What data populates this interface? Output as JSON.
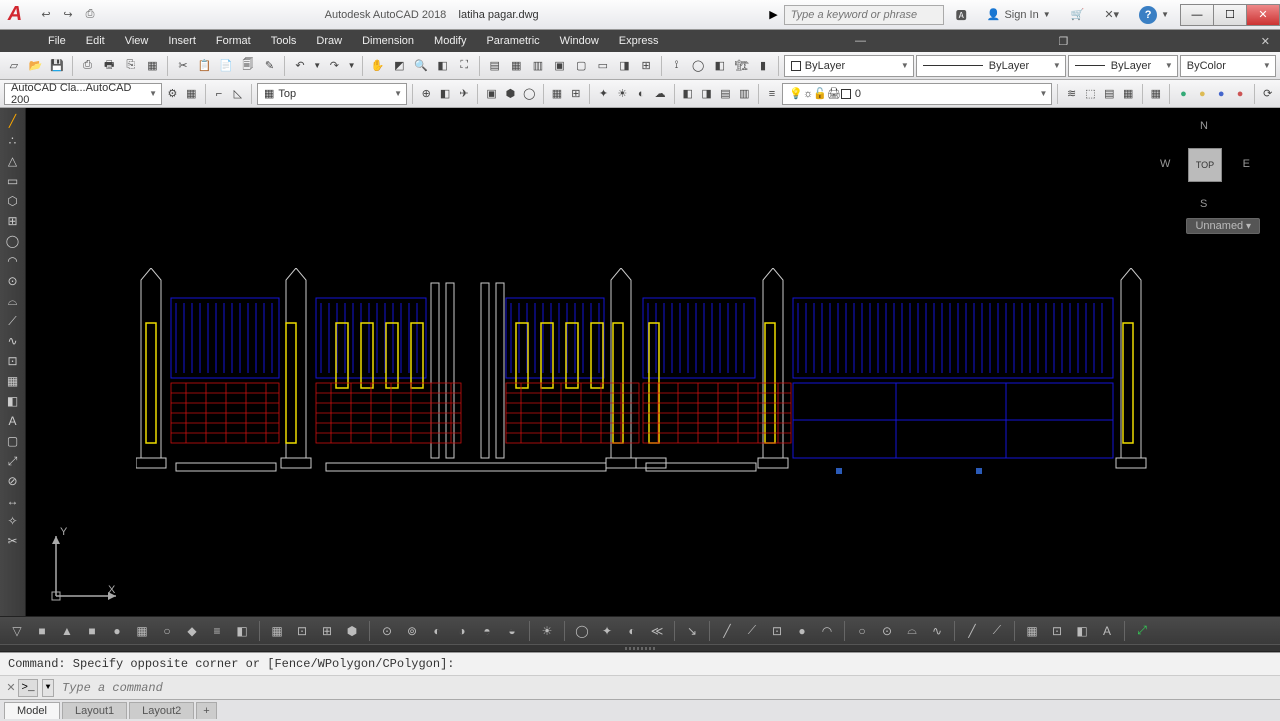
{
  "title": {
    "app": "Autodesk AutoCAD 2018",
    "doc": "latiha pagar.dwg"
  },
  "search_placeholder": "Type a keyword or phrase",
  "signin_label": "Sign In",
  "menus": [
    "File",
    "Edit",
    "View",
    "Insert",
    "Format",
    "Tools",
    "Draw",
    "Dimension",
    "Modify",
    "Parametric",
    "Window",
    "Express"
  ],
  "workspace_combo": "AutoCAD Cla...AutoCAD 200",
  "view_combo": "Top",
  "layer_combo_a": "ByLayer",
  "layer_combo_b": "ByLayer",
  "layer_combo_c": "ByLayer",
  "color_combo": "ByColor",
  "layer_current": "0",
  "viewcube": {
    "top": "TOP",
    "n": "N",
    "s": "S",
    "e": "E",
    "w": "W"
  },
  "unnamed_btn": "Unnamed",
  "ucs": {
    "x": "X",
    "y": "Y"
  },
  "cmd_history": "Command: Specify opposite corner or [Fence/WPolygon/CPolygon]:",
  "cmd_placeholder": "Type a command",
  "tabs": [
    "Model",
    "Layout1",
    "Layout2"
  ],
  "plus": "+",
  "qat_icons": [
    "↩",
    "↪",
    "⎙"
  ],
  "row1_icons_a": [
    "▱",
    "📂",
    "💾",
    "⎙",
    "🖶",
    "⎘",
    "▦"
  ],
  "row1_icons_b": [
    "✂",
    "📋",
    "📄",
    "🗐",
    "✎"
  ],
  "row1_icons_c": [
    "↶",
    "▾",
    "↷",
    "▾"
  ],
  "row1_icons_d": [
    "✋",
    "◩",
    "🔍",
    "◧",
    "⛶"
  ],
  "row1_icons_e": [
    "▤",
    "▦",
    "▥",
    "▣",
    "▢",
    "▭",
    "◨",
    "⊞"
  ],
  "row1_icons_f": [
    "⟟",
    "◯",
    "◧",
    "🏗",
    "▮"
  ],
  "row2_icons_a": [
    "⚙",
    "▦"
  ],
  "row2_icons_b": [
    "⌐",
    "◺"
  ],
  "row2_icons_c": [
    "⊕",
    "◧",
    "✈",
    "",
    "▣",
    "⬢",
    "◯",
    "",
    "▦",
    "⊞",
    "",
    "✦",
    "☀",
    "◐",
    "☁",
    "",
    "◧",
    "◨",
    "▤",
    "▥"
  ],
  "row2_layer_icons": [
    "💡",
    "❄",
    "🔒",
    "🖨",
    "■"
  ],
  "row2_icons_d": [
    "≋",
    "⬚",
    "▤",
    "▦",
    "",
    "▦",
    "",
    "●",
    "●",
    "●",
    "●",
    "",
    "⟳"
  ],
  "left_tools": [
    "╱",
    "●●",
    "△",
    "⊡",
    "⬡",
    "⊞",
    "◯",
    "◠",
    "⊙",
    "⌓",
    "⟋",
    "∿",
    "⊡",
    "▦",
    "◧",
    "A",
    "▢",
    "⤢",
    "⊘",
    "↔",
    "✧",
    "✂"
  ],
  "btm_tools": [
    "▽",
    "■",
    "▲",
    "■",
    "●",
    "▦",
    "○",
    "◆",
    "≡",
    "◧",
    "",
    "▦",
    "⊡",
    "⊞",
    "⬢",
    "",
    "⊙",
    "⊚",
    "◐",
    "◑",
    "◓",
    "◒",
    "",
    "☀",
    "",
    "◯",
    "✦",
    "◐",
    "≪",
    "",
    "↘",
    "",
    "╱",
    "⟋",
    "⊡",
    "●",
    "◠",
    "",
    "○",
    "⊙",
    "⌓",
    "∿",
    "",
    "╱",
    "⟋",
    "",
    "▦",
    "⊡",
    "◧",
    "A",
    "",
    "⤢"
  ]
}
